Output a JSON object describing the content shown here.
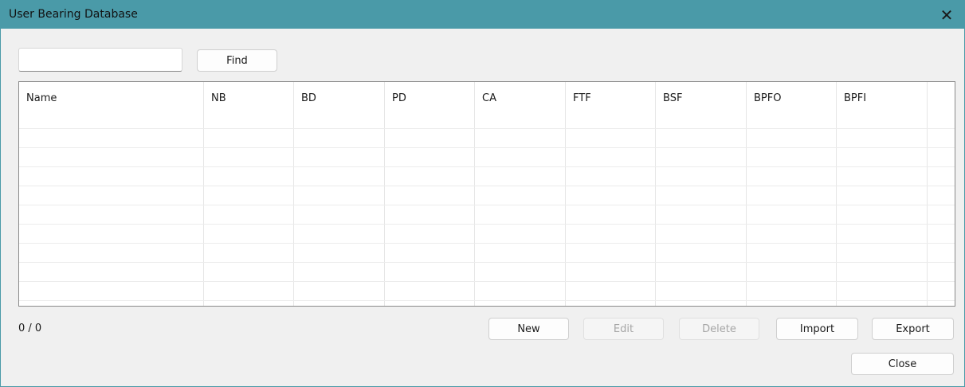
{
  "window": {
    "title": "User Bearing Database"
  },
  "search": {
    "value": "",
    "placeholder": "",
    "find_label": "Find"
  },
  "table": {
    "columns": [
      "Name",
      "NB",
      "BD",
      "PD",
      "CA",
      "FTF",
      "BSF",
      "BPFO",
      "BPFI"
    ],
    "rows": []
  },
  "status": {
    "count": "0 / 0"
  },
  "actions": {
    "new_label": "New",
    "edit_label": "Edit",
    "delete_label": "Delete",
    "import_label": "Import",
    "export_label": "Export",
    "close_label": "Close"
  },
  "icons": {
    "close": "close-icon"
  },
  "colors": {
    "titlebar": "#4a9aa8"
  }
}
